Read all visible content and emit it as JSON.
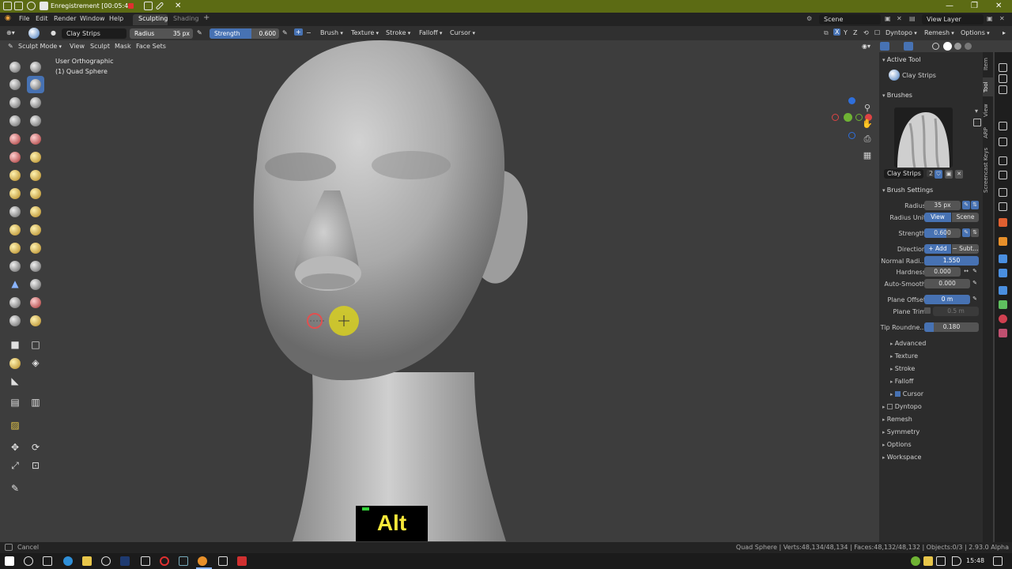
{
  "window": {
    "title": "Enregistrement [00:05:4",
    "min_icon": "minimize-icon",
    "max_icon": "maximize-icon",
    "close_icon": "close-icon"
  },
  "menubar": {
    "menus": [
      "File",
      "Edit",
      "Render",
      "Window",
      "Help"
    ],
    "workspace_tabs": [
      "Sculpting",
      "Shading"
    ],
    "add_tab": "+",
    "scene": "Scene",
    "view_layer": "View Layer"
  },
  "toolheader": {
    "brush_name": "Clay Strips",
    "radius_label": "Radius",
    "radius_value": "35 px",
    "strength_label": "Strength",
    "strength_value": "0.600",
    "strength_fraction": 0.6,
    "menus": [
      "Brush",
      "Texture",
      "Stroke",
      "Falloff",
      "Cursor"
    ],
    "symmetry_axes": [
      "X",
      "Y",
      "Z"
    ],
    "right_menus": [
      "Dyntopo",
      "Remesh",
      "Options"
    ]
  },
  "viewport_header": {
    "mode": "Sculpt Mode",
    "menus": [
      "View",
      "Sculpt",
      "Mask",
      "Face Sets"
    ]
  },
  "viewport": {
    "view_name": "User Orthographic",
    "object_name": "(1) Quad Sphere"
  },
  "key_overlay": {
    "key": "Alt"
  },
  "npanel": {
    "active_tool_title": "Active Tool",
    "active_tool_name": "Clay Strips",
    "brushes_title": "Brushes",
    "brush_name": "Clay Strips",
    "brush_users": "2",
    "brush_settings_title": "Brush Settings",
    "radius_label": "Radius",
    "radius_value": "35 px",
    "radius_unit_label": "Radius Unit",
    "radius_unit_options": [
      "View",
      "Scene"
    ],
    "strength_label": "Strength",
    "strength_value": "0.600",
    "direction_label": "Direction",
    "direction_options": [
      "+ Add",
      "− Subt..."
    ],
    "normal_radius_label": "Normal Radi...",
    "normal_radius_value": "1.550",
    "hardness_label": "Hardness",
    "hardness_value": "0.000",
    "autosmooth_label": "Auto-Smooth",
    "autosmooth_value": "0.000",
    "plane_offset_label": "Plane Offset",
    "plane_offset_value": "0 m",
    "plane_trim_label": "Plane Trim",
    "plane_trim_value": "0.5 m",
    "tip_roundness_label": "Tip Roundne...",
    "tip_roundness_value": "0.180",
    "tip_roundness_fraction": 0.18,
    "subsections": [
      "Advanced",
      "Texture",
      "Stroke",
      "Falloff",
      "Cursor"
    ],
    "panels": [
      "Dyntopo",
      "Remesh",
      "Symmetry",
      "Options",
      "Workspace"
    ]
  },
  "vertical_tabs": [
    "Item",
    "Tool",
    "View",
    "ARP",
    "Screencast Keys"
  ],
  "statusbar": {
    "left": "Cancel",
    "right": "Quad Sphere | Verts:48,134/48,134 | Faces:48,132/48,132 | Objects:0/3 | 2.93.0 Alpha"
  },
  "taskbar": {
    "time": "15:48"
  },
  "colors": {
    "title_bar": "#5c6b14",
    "accent_blue": "#4772b3",
    "viewport_bg": "#3d3d3d",
    "key_text": "#f7e83a"
  }
}
